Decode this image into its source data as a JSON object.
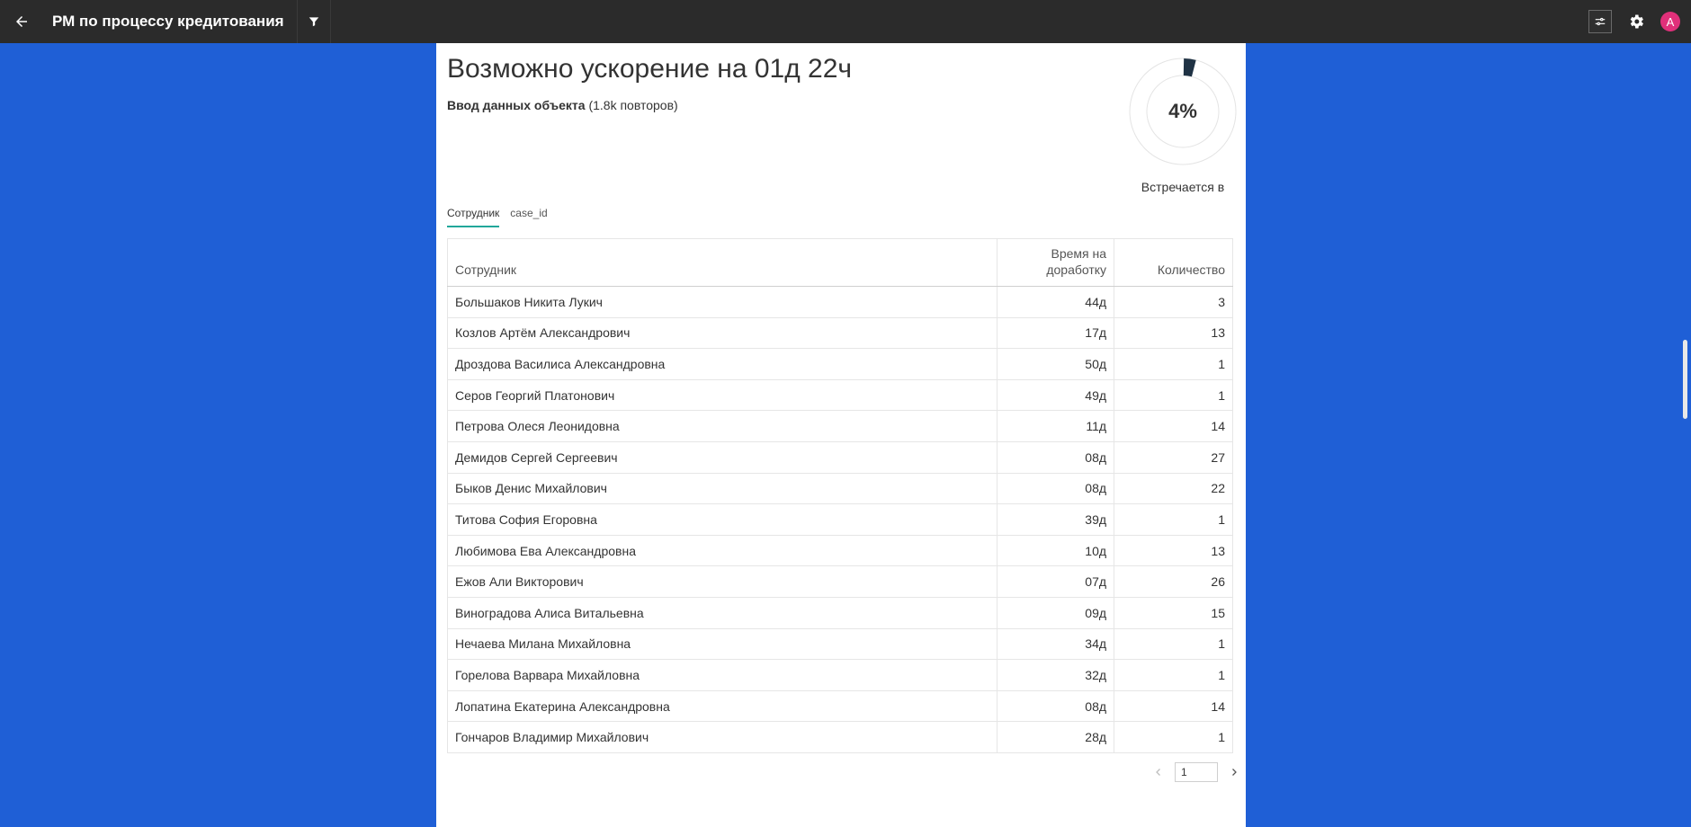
{
  "header": {
    "title": "РМ по процессу кредитования",
    "avatar_letter": "A"
  },
  "summary": {
    "headline": "Возможно ускорение на 01д 22ч",
    "activity": "Ввод данных объекта",
    "repeats": "(1.8k повторов)",
    "donut_percent_text": "4%",
    "donut_fraction": 0.04,
    "donut_caption": "Встречается в"
  },
  "tabs": [
    {
      "label": "Сотрудник"
    },
    {
      "label": "case_id"
    }
  ],
  "table": {
    "headers": {
      "name": "Сотрудник",
      "time_line1": "Время на",
      "time_line2": "доработку",
      "qty": "Количество"
    },
    "rows": [
      {
        "name": "Большаков Никита Лукич",
        "time": "44д",
        "qty": "3"
      },
      {
        "name": "Козлов Артём Александрович",
        "time": "17д",
        "qty": "13"
      },
      {
        "name": "Дроздова Василиса Александровна",
        "time": "50д",
        "qty": "1"
      },
      {
        "name": "Серов Георгий Платонович",
        "time": "49д",
        "qty": "1"
      },
      {
        "name": "Петрова Олеся Леонидовна",
        "time": "11д",
        "qty": "14"
      },
      {
        "name": "Демидов Сергей Сергеевич",
        "time": "08д",
        "qty": "27"
      },
      {
        "name": "Быков Денис Михайлович",
        "time": "08д",
        "qty": "22"
      },
      {
        "name": "Титова София Егоровна",
        "time": "39д",
        "qty": "1"
      },
      {
        "name": "Любимова Ева Александровна",
        "time": "10д",
        "qty": "13"
      },
      {
        "name": "Ежов Али Викторович",
        "time": "07д",
        "qty": "26"
      },
      {
        "name": "Виноградова Алиса Витальевна",
        "time": "09д",
        "qty": "15"
      },
      {
        "name": "Нечаева Милана Михайловна",
        "time": "34д",
        "qty": "1"
      },
      {
        "name": "Горелова Варвара Михайловна",
        "time": "32д",
        "qty": "1"
      },
      {
        "name": "Лопатина Екатерина Александровна",
        "time": "08д",
        "qty": "14"
      },
      {
        "name": "Гончаров Владимир Михайлович",
        "time": "28д",
        "qty": "1"
      }
    ]
  },
  "pager": {
    "page": "1"
  },
  "colors": {
    "background": "#1f5fd6",
    "topbar": "#2b2b2b",
    "tab_accent": "#21a79a",
    "donut_fill": "#1f3244",
    "avatar": "#e0307a"
  }
}
